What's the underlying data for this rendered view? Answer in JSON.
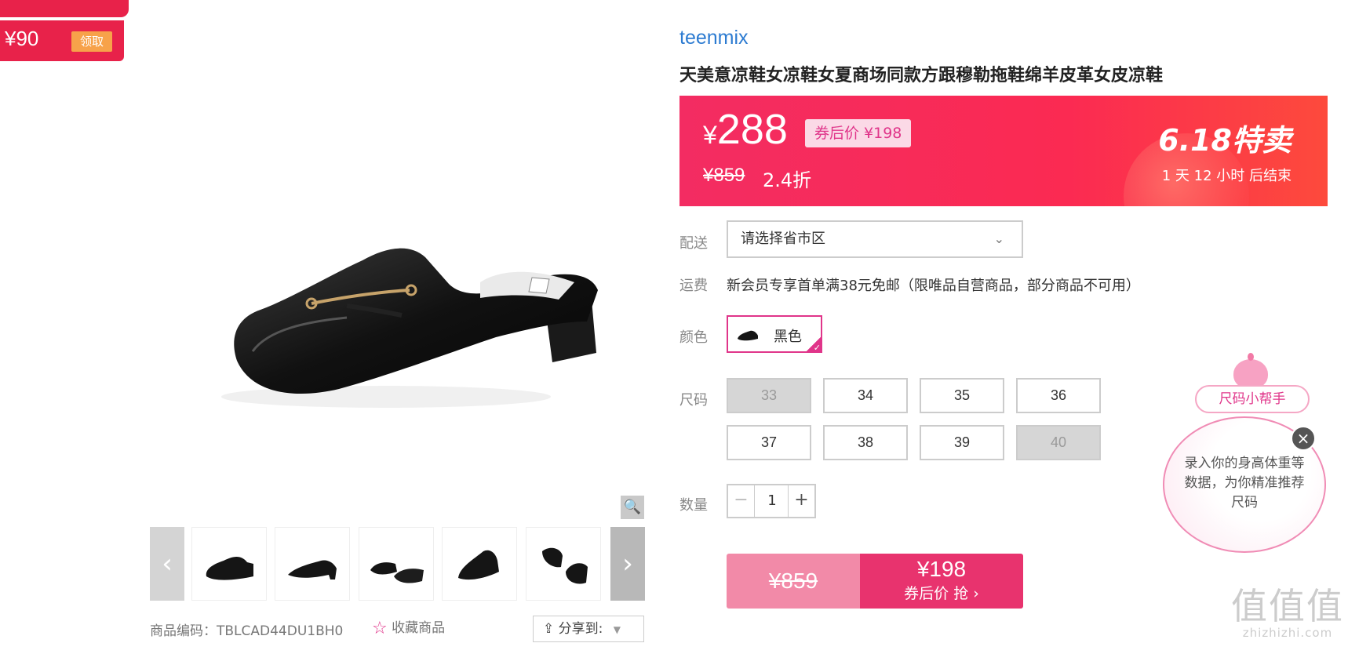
{
  "coupon": {
    "amount": "¥90",
    "claim": "领取"
  },
  "gallery": {
    "zoom_icon": "magnifier-icon",
    "prev_icon": "chevron-left-icon",
    "next_icon": "chevron-right-icon",
    "prev_glyph": "‹",
    "next_glyph": "›",
    "zoom_glyph": "🔍"
  },
  "product": {
    "brand": "teenmix",
    "title": "天美意凉鞋女凉鞋女夏商场同款方跟穆勒拖鞋绵羊皮革女皮凉鞋",
    "sku_label": "商品编码：",
    "sku": "TBLCAD44DU1BH0",
    "favorite": "收藏商品",
    "share": "分享到:"
  },
  "price": {
    "currency": "¥",
    "current": "288",
    "after_coupon_label": "券后价 ¥198",
    "original": "¥859",
    "discount": "2.4折",
    "promo_logo": "6.18特卖",
    "countdown": "1  天  12  小时  后结束"
  },
  "delivery": {
    "label": "配送",
    "placeholder": "请选择省市区"
  },
  "shipping": {
    "label": "运费",
    "text": "新会员专享首单满38元免邮（限唯品自营商品，部分商品不可用）"
  },
  "color": {
    "label": "颜色",
    "selected": "黑色"
  },
  "size": {
    "label": "尺码",
    "options": [
      {
        "value": "33",
        "available": false
      },
      {
        "value": "34",
        "available": true
      },
      {
        "value": "35",
        "available": true
      },
      {
        "value": "36",
        "available": true
      },
      {
        "value": "37",
        "available": true
      },
      {
        "value": "38",
        "available": true
      },
      {
        "value": "39",
        "available": true
      },
      {
        "value": "40",
        "available": false
      }
    ]
  },
  "quantity": {
    "label": "数量",
    "value": "1",
    "minus": "−",
    "plus": "+"
  },
  "buy": {
    "original": "¥859",
    "price": "¥198",
    "action": "券后价 抢 ›"
  },
  "size_helper": {
    "title": "尺码小帮手",
    "text": "录入你的身高体重等数据，为你精准推荐尺码",
    "close": "×"
  },
  "watermark": {
    "main": "值值值",
    "site": "zhizhizhi.com"
  },
  "colors": {
    "accent": "#e8336e",
    "brand_blue": "#2c7bd1",
    "banner": "#fb2a52"
  }
}
